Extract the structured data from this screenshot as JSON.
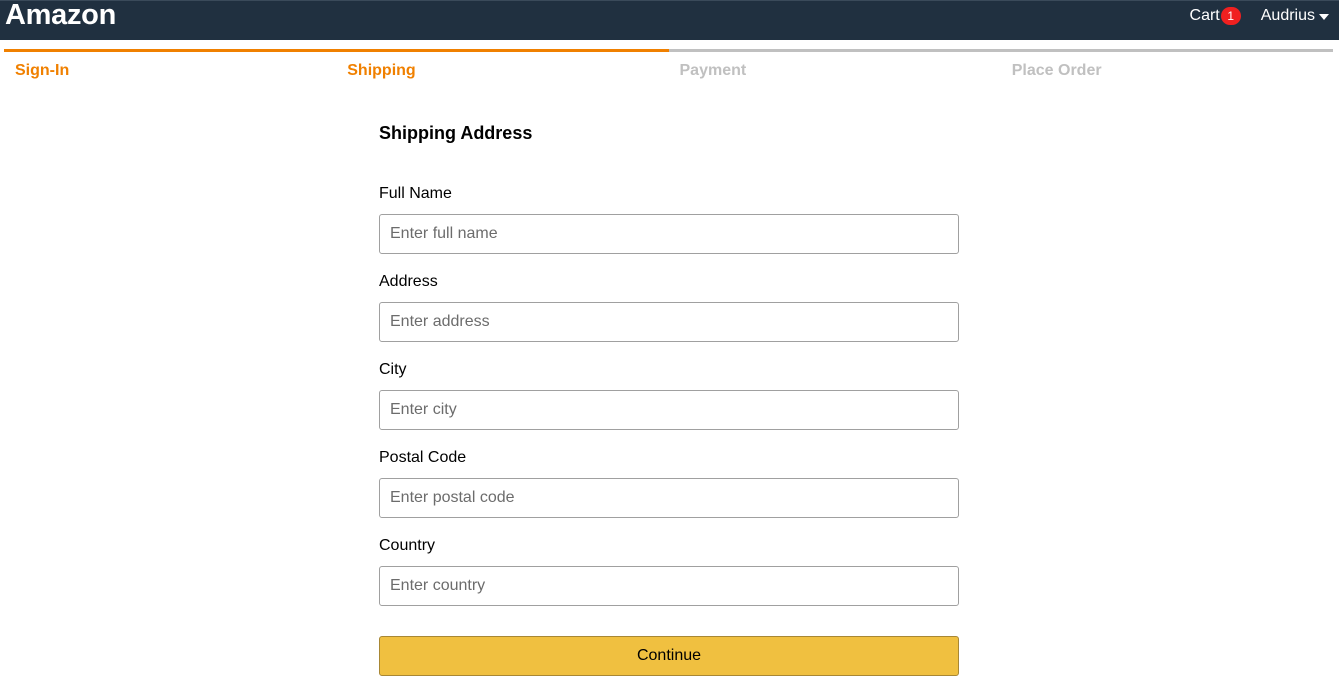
{
  "header": {
    "brand": "Amazon",
    "cart_label": "Cart",
    "cart_count": "1",
    "user_name": "Audrius"
  },
  "steps": [
    {
      "label": "Sign-In",
      "active": true
    },
    {
      "label": "Shipping",
      "active": true
    },
    {
      "label": "Payment",
      "active": false
    },
    {
      "label": "Place Order",
      "active": false
    }
  ],
  "form": {
    "title": "Shipping Address",
    "fields": [
      {
        "label": "Full Name",
        "placeholder": "Enter full name",
        "value": ""
      },
      {
        "label": "Address",
        "placeholder": "Enter address",
        "value": ""
      },
      {
        "label": "City",
        "placeholder": "Enter city",
        "value": ""
      },
      {
        "label": "Postal Code",
        "placeholder": "Enter postal code",
        "value": ""
      },
      {
        "label": "Country",
        "placeholder": "Enter country",
        "value": ""
      }
    ],
    "submit_label": "Continue"
  },
  "colors": {
    "header_bg": "#203040",
    "active_step": "#f08000",
    "inactive_step": "#c0c0c0",
    "button_bg": "#f0c040",
    "badge_bg": "#f02020"
  }
}
